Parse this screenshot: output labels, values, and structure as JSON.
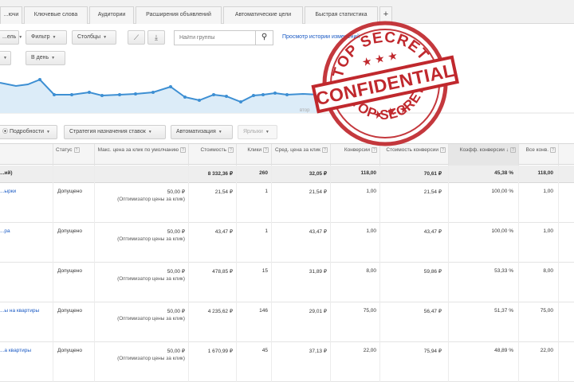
{
  "tabs": [
    {
      "label": "...ючи"
    },
    {
      "label": "Ключевые слова"
    },
    {
      "label": "Аудитории"
    },
    {
      "label": "Расширения объявлений"
    },
    {
      "label": "Автоматические цели"
    },
    {
      "label": "Быстрая статистика"
    },
    {
      "label": "+"
    }
  ],
  "toolbar": {
    "left_btn": "...ель",
    "filter": "Фильтр",
    "columns": "Столбцы",
    "search_placeholder": "Найти группы",
    "history_link": "Просмотр истории изменений",
    "period_btn": "В день"
  },
  "chart": {
    "axis_label_fragment": "втор",
    "color": "#3d8fd3",
    "fill": "#dcecf8"
  },
  "actions": {
    "details": "Подробности",
    "bid_strategy": "Стратегия назначения ставок",
    "automation": "Автоматизация",
    "labels": "Ярлыки"
  },
  "table": {
    "headers": {
      "status": "Статус",
      "max_cpc": "Макс. цена за клик по умолчанию",
      "cost": "Стоимость",
      "clicks": "Клики",
      "avg_cpc": "Сред. цена за клик",
      "conversions": "Конверсии",
      "cost_per_conv": "Стоимость конверсии",
      "conv_rate": "Коэфф. конверсии",
      "all_conv": "Все конв."
    },
    "totals": {
      "label": "...ий)",
      "cost": "8 332,36 ₽",
      "clicks": "260",
      "avg_cpc": "32,05 ₽",
      "conversions": "118,00",
      "cost_per_conv": "70,61 ₽",
      "conv_rate": "45,38 %",
      "all_conv": "118,00"
    },
    "rows": [
      {
        "name": "...ырки",
        "status": "Допущено",
        "bid": "50,00 ₽",
        "bid_note": "(Оптимизатор цены за клик)",
        "cost": "21,54 ₽",
        "clicks": "1",
        "avg_cpc": "21,54 ₽",
        "conversions": "1,00",
        "cost_per_conv": "21,54 ₽",
        "conv_rate": "100,00 %",
        "all_conv": "1,00"
      },
      {
        "name": "...ра",
        "status": "Допущено",
        "bid": "50,00 ₽",
        "bid_note": "(Оптимизатор цены за клик)",
        "cost": "43,47 ₽",
        "clicks": "1",
        "avg_cpc": "43,47 ₽",
        "conversions": "1,00",
        "cost_per_conv": "43,47 ₽",
        "conv_rate": "100,00 %",
        "all_conv": "1,00"
      },
      {
        "name": "",
        "status": "Допущено",
        "bid": "50,00 ₽",
        "bid_note": "(Оптимизатор цены за клик)",
        "cost": "478,85 ₽",
        "clicks": "15",
        "avg_cpc": "31,89 ₽",
        "conversions": "8,00",
        "cost_per_conv": "59,86 ₽",
        "conv_rate": "53,33 %",
        "all_conv": "8,00"
      },
      {
        "name": "...ы на квартиры",
        "status": "Допущено",
        "bid": "50,00 ₽",
        "bid_note": "(Оптимизатор цены за клик)",
        "cost": "4 235,62 ₽",
        "clicks": "146",
        "avg_cpc": "29,01 ₽",
        "conversions": "75,00",
        "cost_per_conv": "56,47 ₽",
        "conv_rate": "51,37 %",
        "all_conv": "75,00"
      },
      {
        "name": "...а квартиры",
        "status": "Допущено",
        "bid": "50,00 ₽",
        "bid_note": "(Оптимизатор цены за клик)",
        "cost": "1 670,99 ₽",
        "clicks": "45",
        "avg_cpc": "37,13 ₽",
        "conversions": "22,00",
        "cost_per_conv": "75,94 ₽",
        "conv_rate": "48,89 %",
        "all_conv": "22,00"
      }
    ]
  },
  "stamp": {
    "top_text": "TOP SECRET",
    "middle_text": "CONFIDENTIAL",
    "bottom_text": "TOP SECRET",
    "color": "#c0282d"
  }
}
